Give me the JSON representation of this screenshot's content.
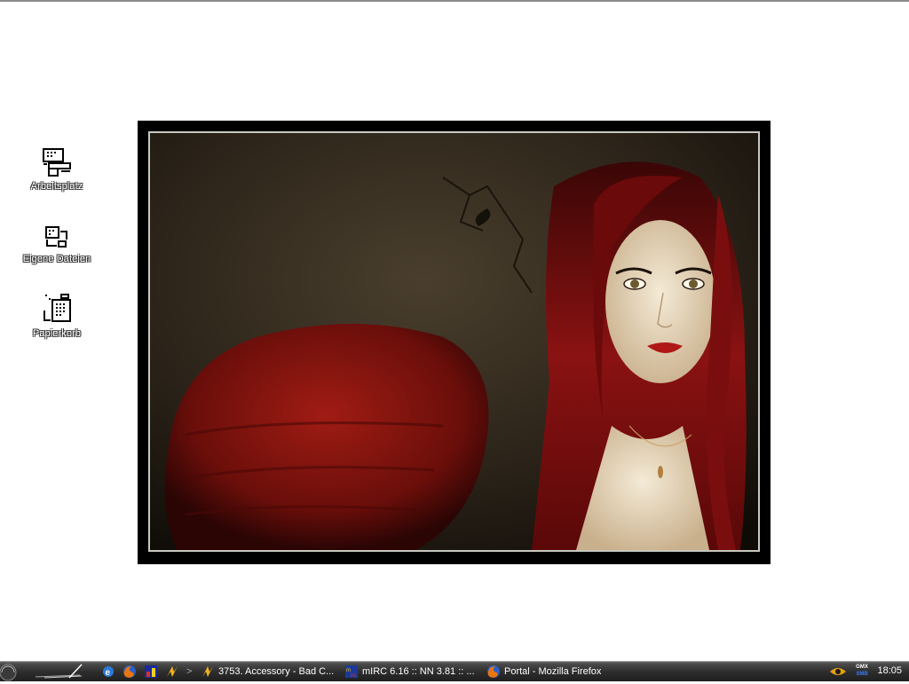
{
  "desktop": {
    "icons": [
      {
        "label": "Arbeitsplatz",
        "icon": "computer-icon"
      },
      {
        "label": "Eigene Dateien",
        "icon": "documents-icon"
      },
      {
        "label": "Papierkorb",
        "icon": "recycle-bin-icon"
      }
    ],
    "wallpaper": {
      "icon": "photo-wallpaper",
      "description_colors": {
        "hair": "#8a1212",
        "background": "#2a2218"
      }
    }
  },
  "taskbar": {
    "quick_launch": [
      {
        "icon": "internet-explorer-icon"
      },
      {
        "icon": "firefox-icon"
      },
      {
        "icon": "winamp-app-icon"
      },
      {
        "icon": "media-app-icon"
      }
    ],
    "overflow_glyph": ">",
    "tasks": [
      {
        "icon": "winamp-icon",
        "label": "3753. Accessory - Bad C..."
      },
      {
        "icon": "mirc-icon",
        "label": "mIRC 6.16 :: NN 3.81 :: ..."
      },
      {
        "icon": "firefox-icon",
        "label": "Portal - Mozilla Firefox"
      }
    ],
    "tray": {
      "icons": [
        {
          "icon": "eye-icon"
        },
        {
          "icon": "gmx-smb-icon",
          "text_top": "GMX",
          "text_bottom": "SMB"
        }
      ],
      "clock": "18:05"
    }
  },
  "colors": {
    "taskbar": "#2e2e2e",
    "desktop": "#ffffff"
  }
}
